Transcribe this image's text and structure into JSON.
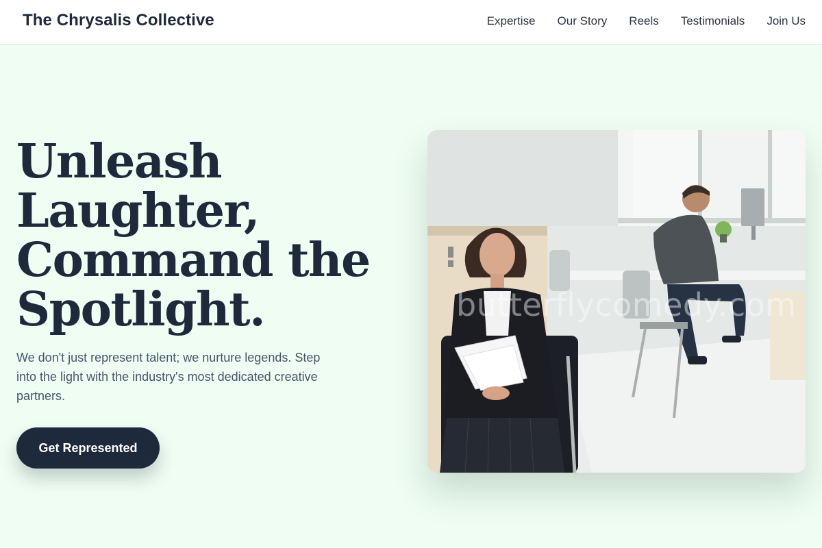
{
  "header": {
    "brand": "The Chrysalis Collective",
    "nav": [
      "Expertise",
      "Our Story",
      "Reels",
      "Testimonials",
      "Join Us"
    ]
  },
  "hero": {
    "title_lines": [
      "Unleash",
      "Laughter,",
      "Command the",
      "Spotlight."
    ],
    "subtitle": "We don't just represent talent; we nurture legends. Step into the light with the industry's most dedicated creative partners.",
    "cta_label": "Get Represented",
    "image_watermark": "butterflycomedy.com"
  },
  "colors": {
    "page_background": "#effdf3",
    "primary": "#1e293b",
    "body_text": "#475569"
  }
}
